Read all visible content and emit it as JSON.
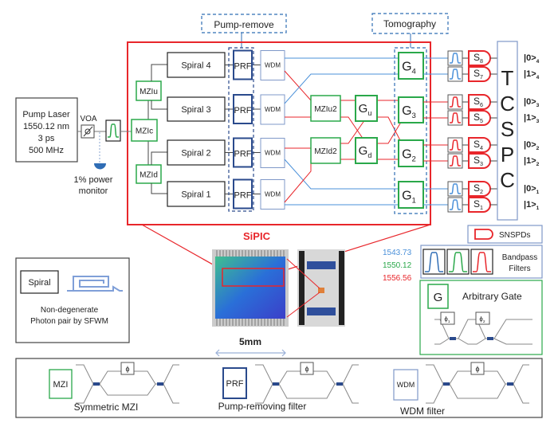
{
  "colors": {
    "red": "#e8262b",
    "green": "#2aa84a",
    "blue": "#2f6db5",
    "navy": "#2a4a8c",
    "gray": "#888888",
    "wdm": "#7f98c8",
    "lightblue": "#4a90d9"
  },
  "labels": {
    "pump_remove": "Pump-remove",
    "tomography": "Tomography",
    "laser": [
      "Pump Laser",
      "1550.12 nm",
      "3 ps",
      "500 MHz"
    ],
    "voa": "VOA",
    "monitor": [
      "1% power",
      "monitor"
    ],
    "mzic": "MZIc",
    "mziu": "MZIu",
    "mzid": "MZId",
    "mziu2": "MZIu2",
    "mzid2": "MZId2",
    "gu": {
      "main": "G",
      "sub": "u"
    },
    "gd": {
      "main": "G",
      "sub": "d"
    },
    "spirals": [
      "Spiral 4",
      "Spiral 3",
      "Spiral 2",
      "Spiral 1"
    ],
    "prf": "PRF",
    "wdm": "WDM",
    "gates": [
      {
        "main": "G",
        "sub": "4"
      },
      {
        "main": "G",
        "sub": "3"
      },
      {
        "main": "G",
        "sub": "2"
      },
      {
        "main": "G",
        "sub": "1"
      }
    ],
    "detectors": [
      {
        "main": "S",
        "sub": "8"
      },
      {
        "main": "S",
        "sub": "7"
      },
      {
        "main": "S",
        "sub": "6"
      },
      {
        "main": "S",
        "sub": "5"
      },
      {
        "main": "S",
        "sub": "4"
      },
      {
        "main": "S",
        "sub": "3"
      },
      {
        "main": "S",
        "sub": "2"
      },
      {
        "main": "S",
        "sub": "1"
      }
    ],
    "filter_colors": [
      "blue",
      "blue",
      "red",
      "red",
      "red",
      "red",
      "blue",
      "blue"
    ],
    "tcspc": [
      "T",
      "C",
      "S",
      "P",
      "C"
    ],
    "kets": [
      {
        "main": "|0>",
        "sub": "4"
      },
      {
        "main": "|1>",
        "sub": "4"
      },
      {
        "main": "|0>",
        "sub": "3"
      },
      {
        "main": "|1>",
        "sub": "3"
      },
      {
        "main": "|0>",
        "sub": "2"
      },
      {
        "main": "|1>",
        "sub": "2"
      },
      {
        "main": "|0>",
        "sub": "1"
      },
      {
        "main": "|1>",
        "sub": "1"
      }
    ],
    "sipic": "SiPIC",
    "scale": "5mm"
  },
  "legend": {
    "snspds": "SNSPDs",
    "wavelengths": [
      {
        "value": "1543.73",
        "color": "#4a90d9"
      },
      {
        "value": "1550.12",
        "color": "#2aa84a"
      },
      {
        "value": "1556.56",
        "color": "#e8262b"
      }
    ],
    "bandpass": [
      "Bandpass",
      "Filters"
    ],
    "gate_letter": "G",
    "arbitrary_gate": "Arbitrary Gate",
    "phi1": {
      "main": "ϕ",
      "sub": "1"
    },
    "phi2": {
      "main": "ϕ",
      "sub": "2"
    },
    "spiral": "Spiral",
    "spiral_desc": [
      "Non-degenerate",
      "Photon pair by SFWM"
    ],
    "mzi": "MZI",
    "mzi_desc": "Symmetric MZI",
    "prf": "PRF",
    "prf_desc": "Pump-removing filter",
    "wdm": "WDM",
    "wdm_desc": "WDM filter",
    "phi": "ϕ"
  }
}
